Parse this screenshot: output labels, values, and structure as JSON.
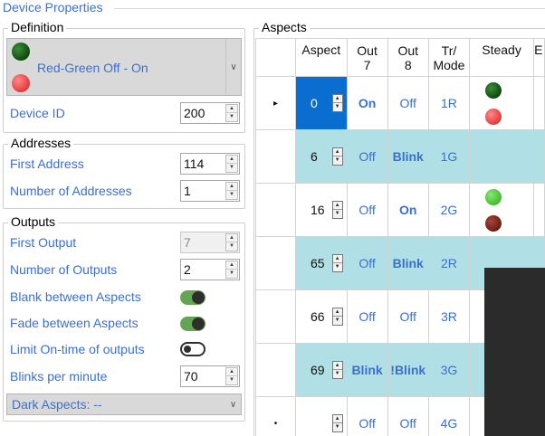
{
  "title": "Device Properties",
  "definition": {
    "label": "Definition",
    "combo_text": "Red-Green Off - On",
    "lamps": [
      "dark-green",
      "red"
    ],
    "device_id_label": "Device ID",
    "device_id": "200"
  },
  "addresses": {
    "label": "Addresses",
    "first_address_label": "First Address",
    "first_address": "114",
    "num_addresses_label": "Number of Addresses",
    "num_addresses": "1"
  },
  "outputs": {
    "label": "Outputs",
    "first_output_label": "First Output",
    "first_output": "7",
    "num_outputs_label": "Number of Outputs",
    "num_outputs": "2",
    "blank_label": "Blank between Aspects",
    "blank_on": true,
    "fade_label": "Fade between Aspects",
    "fade_on": true,
    "limit_label": "Limit On-time of outputs",
    "limit_on": false,
    "blinks_label": "Blinks per minute",
    "blinks": "70",
    "dark_aspects": "Dark Aspects: --"
  },
  "aspects": {
    "label": "Aspects",
    "columns": [
      "Aspect",
      "Out 7",
      "Out 8",
      "Tr/ Mode",
      "Steady",
      "E"
    ],
    "rows": [
      {
        "marker": "▸",
        "aspect": "0",
        "out7": "On",
        "out8": "Off",
        "mode": "1R",
        "steady": [
          "dark-green",
          "red"
        ],
        "teal": false,
        "selected": true
      },
      {
        "marker": "",
        "aspect": "6",
        "out7": "Off",
        "out8": "Blink",
        "mode": "1G",
        "steady": [],
        "teal": true,
        "selected": false
      },
      {
        "marker": "",
        "aspect": "16",
        "out7": "Off",
        "out8": "On",
        "mode": "2G",
        "steady": [
          "light-green",
          "dark-red"
        ],
        "teal": false,
        "selected": false
      },
      {
        "marker": "",
        "aspect": "65",
        "out7": "Off",
        "out8": "Blink",
        "mode": "2R",
        "steady": [],
        "teal": true,
        "selected": false
      },
      {
        "marker": "",
        "aspect": "66",
        "out7": "Off",
        "out8": "Off",
        "mode": "3R",
        "steady": [],
        "teal": false,
        "selected": false
      },
      {
        "marker": "",
        "aspect": "69",
        "out7": "Blink",
        "out8": "!Blink",
        "mode": "3G",
        "steady": [],
        "teal": true,
        "selected": false
      },
      {
        "marker": "•",
        "aspect": "",
        "out7": "Off",
        "out8": "Off",
        "mode": "4G",
        "steady": [],
        "teal": false,
        "selected": false
      }
    ]
  }
}
